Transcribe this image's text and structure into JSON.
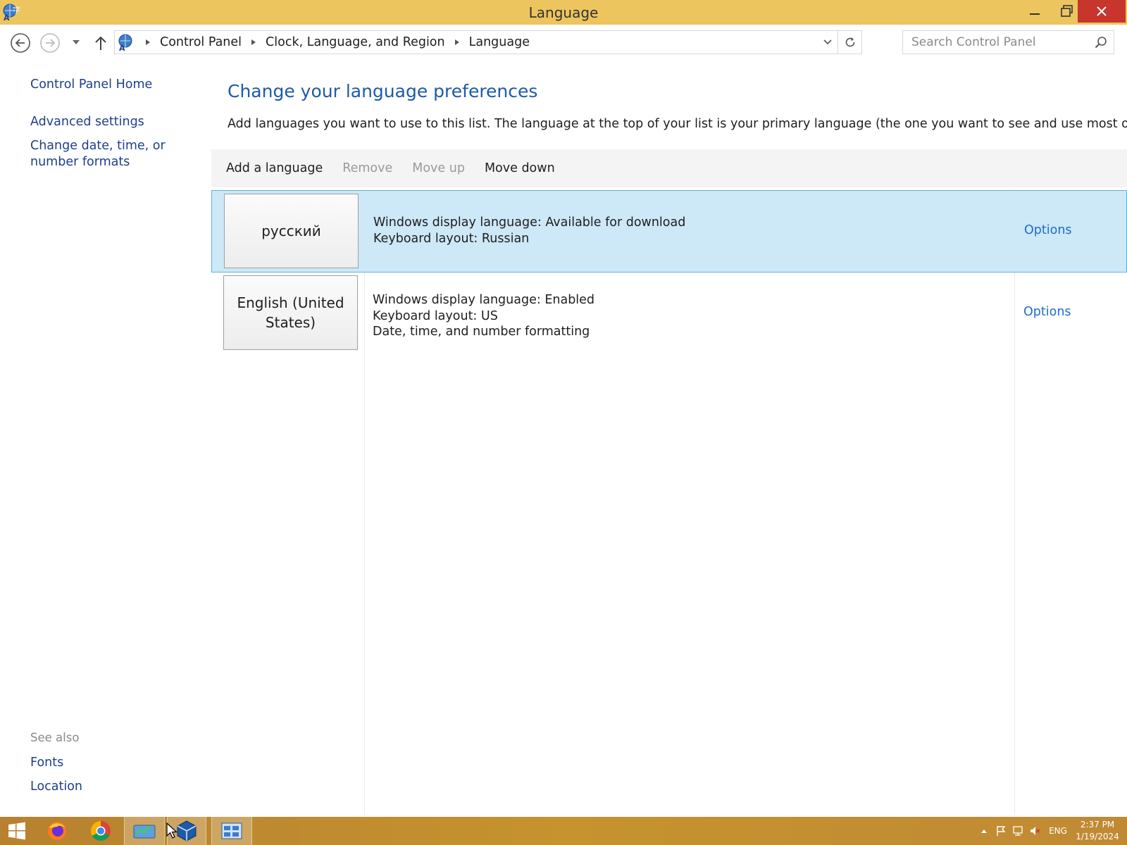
{
  "window": {
    "title": "Language",
    "accent_color": "#edc55f",
    "close_color": "#c7352c"
  },
  "breadcrumb": {
    "items": [
      "Control Panel",
      "Clock, Language, and Region",
      "Language"
    ]
  },
  "search": {
    "placeholder": "Search Control Panel"
  },
  "sidebar": {
    "links": [
      "Control Panel Home",
      "Advanced settings",
      "Change date, time, or number formats"
    ],
    "see_also_label": "See also",
    "see_also_links": [
      "Fonts",
      "Location"
    ]
  },
  "main": {
    "heading": "Change your language preferences",
    "description": "Add languages you want to use to this list. The language at the top of your list is your primary language (the one you want to see and use most often).",
    "toolbar": {
      "add_label": "Add a language",
      "remove_label": "Remove",
      "move_up_label": "Move up",
      "move_down_label": "Move down"
    },
    "languages": [
      {
        "name": "русский",
        "lines": [
          "Windows display language: Available for download",
          "Keyboard layout: Russian"
        ],
        "options_label": "Options",
        "selected": true
      },
      {
        "name": "English (United States)",
        "lines": [
          "Windows display language: Enabled",
          "Keyboard layout: US",
          "Date, time, and number formatting"
        ],
        "options_label": "Options",
        "selected": false
      }
    ]
  },
  "taskbar": {
    "apps": [
      "start-icon",
      "firefox-icon",
      "chrome-icon",
      "control-panel-icon",
      "virtualbox-icon",
      "language-window-icon"
    ],
    "tray": {
      "input_language": "ENG",
      "time": "2:37 PM",
      "date": "1/19/2024"
    }
  }
}
